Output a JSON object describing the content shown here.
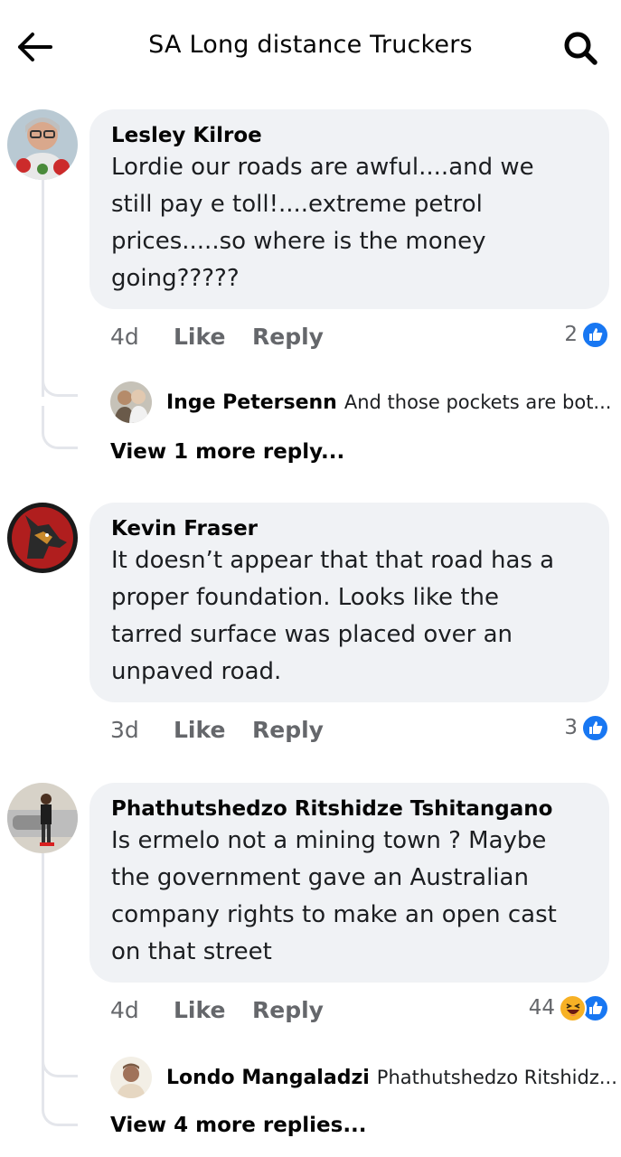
{
  "header": {
    "title": "SA Long distance Truckers",
    "back_icon": "arrow-left-icon",
    "search_icon": "search-icon"
  },
  "comments": [
    {
      "author": "Lesley Kilroe",
      "text_lines": [
        "Lordie our roads are awful....and we",
        "still pay e toll!....extreme petrol",
        "prices.....so where is the money",
        "going?????"
      ],
      "time": "4d",
      "like_label": "Like",
      "reply_label": "Reply",
      "reaction_count": "2",
      "reply_preview": {
        "author": "Inge Petersenn",
        "text": "And those pockets are bot..."
      },
      "more_replies": "View 1 more reply..."
    },
    {
      "author": "Kevin Fraser",
      "text_lines": [
        "It doesn’t appear that that road has a",
        "proper foundation. Looks like the",
        "tarred surface was placed over an",
        "unpaved road."
      ],
      "time": "3d",
      "like_label": "Like",
      "reply_label": "Reply",
      "reaction_count": "3"
    },
    {
      "author": "Phathutshedzo Ritshidze Tshitangano",
      "text_lines": [
        "Is ermelo not a mining town ? Maybe",
        "the government gave an Australian",
        "company rights to  make an open cast",
        "on that street"
      ],
      "time": "4d",
      "like_label": "Like",
      "reply_label": "Reply",
      "reaction_count": "44",
      "reply_preview": {
        "author": "Londo Mangaladzi",
        "text": "Phathutshedzo Ritshidz..."
      },
      "more_replies": "View 4 more replies..."
    }
  ],
  "colors": {
    "bubble": "#f0f2f5",
    "like_blue": "#1877f2",
    "haha_yellow": "#f7b125",
    "meta_gray": "#65676b"
  }
}
